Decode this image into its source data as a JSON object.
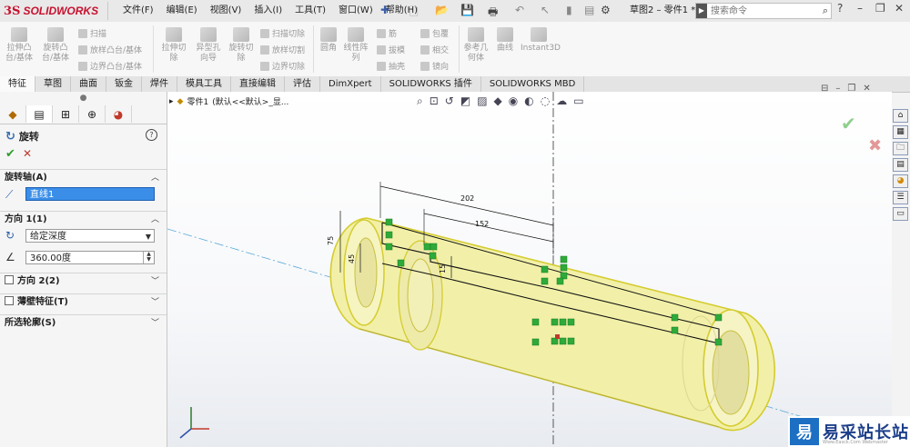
{
  "app": {
    "logo_prefix": "3S",
    "logo_name": "SOLIDWORKS"
  },
  "menu": [
    "文件(F)",
    "编辑(E)",
    "视图(V)",
    "插入(I)",
    "工具(T)",
    "窗口(W)",
    "帮助(H)"
  ],
  "title": {
    "document": "草图2 – 零件1 *",
    "search_placeholder": "搜索命令"
  },
  "ribbon": {
    "extrude_boss": "拉伸凸\n台/基体",
    "revolve_boss": "旋转凸\n台/基体",
    "sweep": "扫描",
    "loft": "放样凸台/基体",
    "boundary_boss": "边界凸台/基体",
    "extrude_cut": "拉伸切\n除",
    "hole_wizard": "异型孔\n向导",
    "revolve_cut": "旋转切\n除",
    "swept_cut": "扫描切除",
    "lofted_cut": "放样切割",
    "boundary_cut": "边界切除",
    "fillet": "圆角",
    "linear_pattern": "线性阵\n列",
    "rib": "筋",
    "draft": "拔模",
    "shell": "抽壳",
    "wrap": "包覆",
    "intersect": "相交",
    "mirror": "镜向",
    "ref_geometry": "参考几\n何体",
    "curves": "曲线",
    "instant3d": "Instant3D"
  },
  "tabs": [
    "特征",
    "草图",
    "曲面",
    "钣金",
    "焊件",
    "模具工具",
    "直接编辑",
    "评估",
    "DimXpert",
    "SOLIDWORKS 插件",
    "SOLIDWORKS MBD"
  ],
  "property_manager": {
    "title": "旋转",
    "help": "?",
    "axis_header": "旋转轴(A)",
    "axis_value": "直线1",
    "dir1_header": "方向 1(1)",
    "end_condition": "给定深度",
    "angle": "360.00度",
    "dir2_header": "方向 2(2)",
    "thin_header": "薄壁特征(T)",
    "contours_header": "所选轮廓(S)"
  },
  "tree": {
    "part": "零件1",
    "config": "(默认<<默认>_显..."
  },
  "sketch": {
    "dim_202": "202",
    "dim_152": "152",
    "dim_75": "75",
    "dim_45": "45",
    "dim_15": "15"
  },
  "watermark": {
    "logo": "易",
    "text": "易采站长站",
    "url": "Www.Easck.Com  Webmaster"
  },
  "colors": {
    "accent_red": "#c8102e",
    "highlight_blue": "#3a8ee8",
    "part_yellow": "#f2f0a8",
    "relation_green": "#2faa3a"
  }
}
